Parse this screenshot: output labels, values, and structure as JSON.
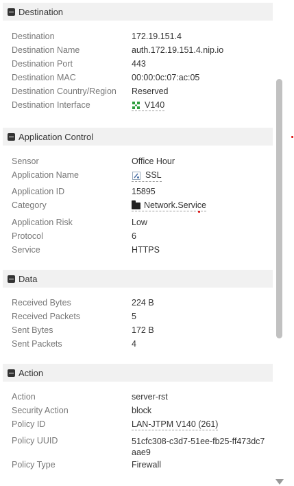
{
  "sections": {
    "destination": {
      "title": "Destination",
      "rows": [
        {
          "label": "Destination",
          "value": "172.19.151.4"
        },
        {
          "label": "Destination Name",
          "value": "auth.172.19.151.4.nip.io"
        },
        {
          "label": "Destination Port",
          "value": "443"
        },
        {
          "label": "Destination MAC",
          "value": "00:00:0c:07:ac:05"
        },
        {
          "label": "Destination Country/Region",
          "value": "Reserved"
        },
        {
          "label": "Destination Interface",
          "value": "V140"
        }
      ]
    },
    "application_control": {
      "title": "Application Control",
      "rows": [
        {
          "label": "Sensor",
          "value": "Office Hour"
        },
        {
          "label": "Application Name",
          "value": "SSL"
        },
        {
          "label": "Application ID",
          "value": "15895"
        },
        {
          "label": "Category",
          "value": "Network.Service"
        },
        {
          "label": "Application Risk",
          "value": "Low"
        },
        {
          "label": "Protocol",
          "value": "6"
        },
        {
          "label": "Service",
          "value": "HTTPS"
        }
      ]
    },
    "data": {
      "title": "Data",
      "rows": [
        {
          "label": "Received Bytes",
          "value": "224 B"
        },
        {
          "label": "Received Packets",
          "value": "5"
        },
        {
          "label": "Sent Bytes",
          "value": "172 B"
        },
        {
          "label": "Sent Packets",
          "value": "4"
        }
      ]
    },
    "action": {
      "title": "Action",
      "rows": [
        {
          "label": "Action",
          "value": "server-rst"
        },
        {
          "label": "Security Action",
          "value": "block"
        },
        {
          "label": "Policy ID",
          "value": "LAN-JTPM V140 (261)"
        },
        {
          "label": "Policy UUID",
          "value_line1": "51cfc308-c3d7-51ee-fb25-ff473dc7",
          "value_line2": "aae9"
        },
        {
          "label": "Policy Type",
          "value": "Firewall"
        }
      ]
    }
  },
  "colors": {
    "header_bg": "#f1f1f1",
    "label": "#777777",
    "value": "#333333",
    "interface_icon": "#2e9e3e",
    "scrollbar_thumb": "#c1c1c1"
  },
  "icons": {
    "section_toggle": "collapse-icon",
    "interface": "network-interface-icon",
    "application": "application-icon",
    "category": "folder-icon"
  }
}
